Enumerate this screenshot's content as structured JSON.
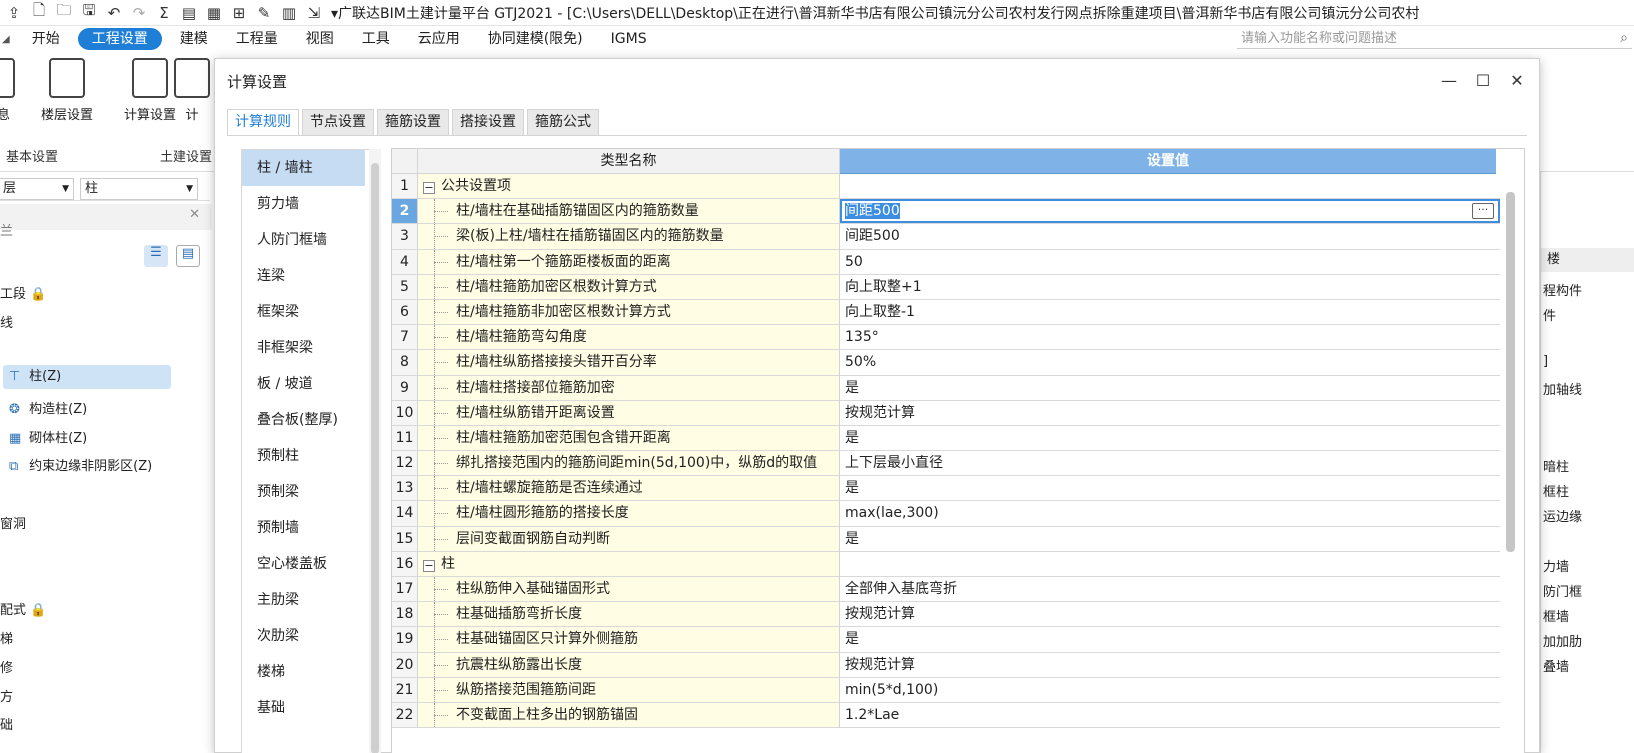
{
  "titlebar": {
    "title": "▾广联达BIM土建计量平台 GTJ2021 - [C:\\Users\\DELL\\Desktop\\正在进行\\普洱新华书店有限公司镇沅分公司农村发行网点拆除重建项目\\普洱新华书店有限公司镇沅分公司农村",
    "icons": [
      "upload-icon",
      "new-file-icon",
      "open-folder-icon",
      "save-icon",
      "undo-icon",
      "redo-icon",
      "sum-icon",
      "report-icon",
      "grid-icon",
      "table-icon",
      "pencil-icon",
      "column-icon",
      "export-icon"
    ]
  },
  "menubar": {
    "items": [
      "开始",
      "工程设置",
      "建模",
      "工程量",
      "视图",
      "工具",
      "云应用",
      "协同建模(限免)",
      "IGMS"
    ],
    "active": "工程设置",
    "search_placeholder": "请输入功能名称或问题描述"
  },
  "ribbon": {
    "buttons": [
      "信息",
      "楼层设置",
      "计算设置",
      "计"
    ],
    "groups": [
      "基本设置",
      "土建设置"
    ]
  },
  "leftpanel": {
    "floor_select": "层",
    "type_select": "柱",
    "header": "兰",
    "items": [
      "工段",
      "线",
      "柱(Z)",
      "构造柱(Z)",
      "砌体柱(Z)",
      "约束边缘非阴影区(Z)",
      "窗洞",
      "配式",
      "梯",
      "修",
      "方",
      "础"
    ]
  },
  "rightstrip": {
    "items": [
      "楼",
      "程构件",
      "件",
      "]",
      "加轴线",
      "暗柱",
      "框柱",
      "运边缘",
      "力墙",
      "防门框",
      "框墙",
      "加加肋",
      "叠墙"
    ]
  },
  "dialog": {
    "title": "计算设置",
    "tabs": [
      "计算规则",
      "节点设置",
      "箍筋设置",
      "搭接设置",
      "箍筋公式"
    ],
    "categories": [
      "柱 / 墙柱",
      "剪力墙",
      "人防门框墙",
      "连梁",
      "框架梁",
      "非框架梁",
      "板 / 坡道",
      "叠合板(整厚)",
      "预制柱",
      "预制梁",
      "预制墙",
      "空心楼盖板",
      "主肋梁",
      "次肋梁",
      "楼梯",
      "基础"
    ],
    "grid": {
      "header_name": "类型名称",
      "header_value": "设置值",
      "rows": [
        {
          "num": "1",
          "name": "公共设置项",
          "value": "",
          "group": true
        },
        {
          "num": "2",
          "name": "柱/墙柱在基础插筋锚固区内的箍筋数量",
          "value": "间距500",
          "selected": true
        },
        {
          "num": "3",
          "name": "梁(板)上柱/墙柱在插筋锚固区内的箍筋数量",
          "value": "间距500"
        },
        {
          "num": "4",
          "name": "柱/墙柱第一个箍筋距楼板面的距离",
          "value": "50"
        },
        {
          "num": "5",
          "name": "柱/墙柱箍筋加密区根数计算方式",
          "value": "向上取整+1"
        },
        {
          "num": "6",
          "name": "柱/墙柱箍筋非加密区根数计算方式",
          "value": "向上取整-1"
        },
        {
          "num": "7",
          "name": "柱/墙柱箍筋弯勾角度",
          "value": "135°"
        },
        {
          "num": "8",
          "name": "柱/墙柱纵筋搭接接头错开百分率",
          "value": "50%"
        },
        {
          "num": "9",
          "name": "柱/墙柱搭接部位箍筋加密",
          "value": "是"
        },
        {
          "num": "10",
          "name": "柱/墙柱纵筋错开距离设置",
          "value": "按规范计算"
        },
        {
          "num": "11",
          "name": "柱/墙柱箍筋加密范围包含错开距离",
          "value": "是"
        },
        {
          "num": "12",
          "name": "绑扎搭接范围内的箍筋间距min(5d,100)中，纵筋d的取值",
          "value": "上下层最小直径"
        },
        {
          "num": "13",
          "name": "柱/墙柱螺旋箍筋是否连续通过",
          "value": "是"
        },
        {
          "num": "14",
          "name": "柱/墙柱圆形箍筋的搭接长度",
          "value": "max(lae,300)"
        },
        {
          "num": "15",
          "name": "层间变截面钢筋自动判断",
          "value": "是"
        },
        {
          "num": "16",
          "name": "柱",
          "value": "",
          "group": true
        },
        {
          "num": "17",
          "name": "柱纵筋伸入基础锚固形式",
          "value": "全部伸入基底弯折"
        },
        {
          "num": "18",
          "name": "柱基础插筋弯折长度",
          "value": "按规范计算"
        },
        {
          "num": "19",
          "name": "柱基础锚固区只计算外侧箍筋",
          "value": "是"
        },
        {
          "num": "20",
          "name": "抗震柱纵筋露出长度",
          "value": "按规范计算"
        },
        {
          "num": "21",
          "name": "纵筋搭接范围箍筋间距",
          "value": "min(5*d,100)"
        },
        {
          "num": "22",
          "name": "不变截面上柱多出的钢筋锚固",
          "value": "1.2*Lae"
        }
      ]
    }
  }
}
